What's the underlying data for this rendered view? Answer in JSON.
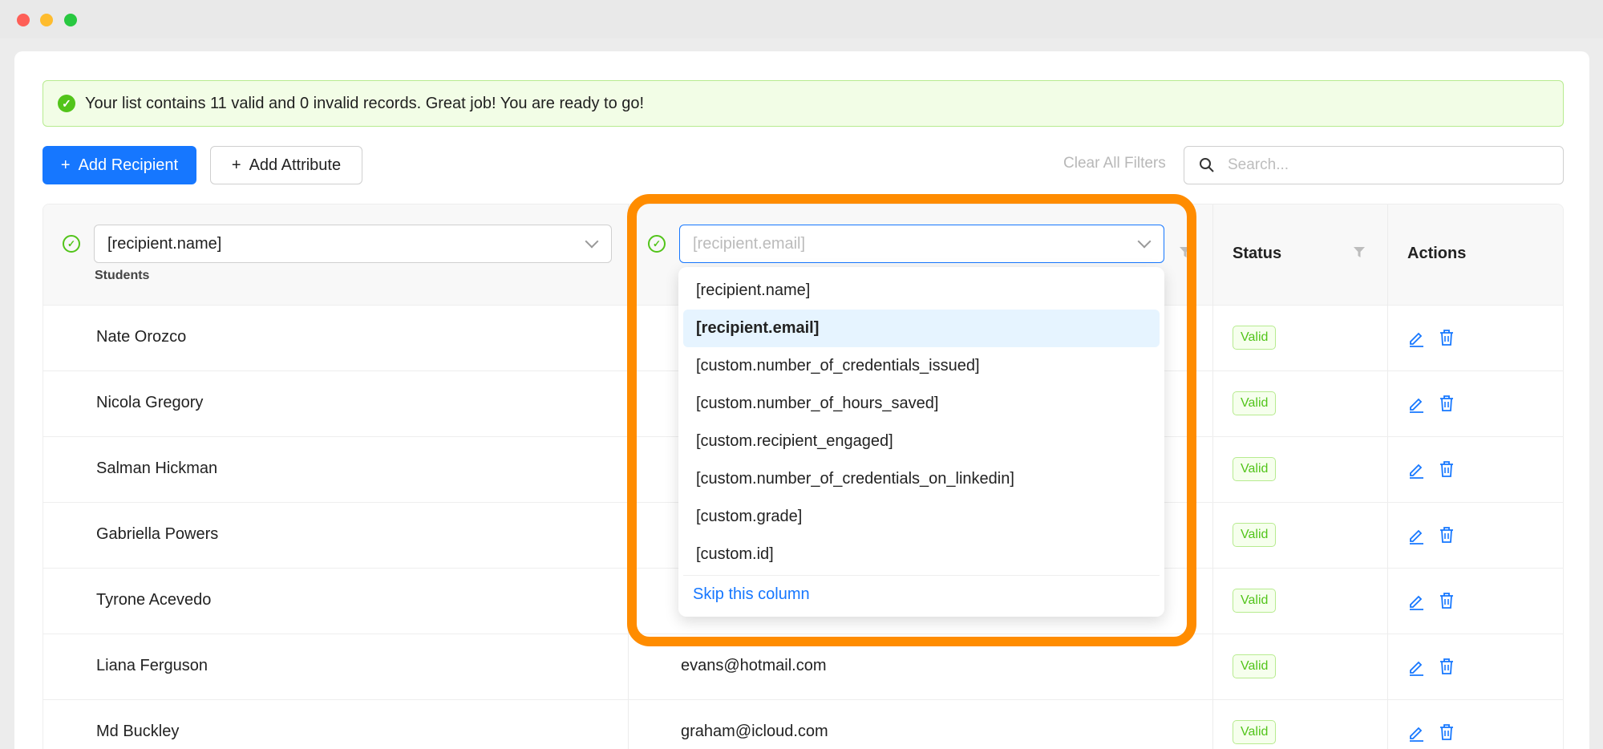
{
  "banner": {
    "message": "Your list contains 11 valid and 0 invalid records. Great job! You are ready to go!"
  },
  "toolbar": {
    "add_recipient": "Add Recipient",
    "add_attribute": "Add Attribute",
    "clear_filters": "Clear All Filters",
    "search_placeholder": "Search..."
  },
  "table": {
    "name_column": {
      "selected": "[recipient.name]",
      "sublabel": "Students"
    },
    "email_column": {
      "placeholder": "[recipient.email]"
    },
    "status_header": "Status",
    "actions_header": "Actions",
    "rows": [
      {
        "name": "Nate Orozco",
        "email": "",
        "status": "Valid"
      },
      {
        "name": "Nicola Gregory",
        "email": "",
        "status": "Valid"
      },
      {
        "name": "Salman Hickman",
        "email": "",
        "status": "Valid"
      },
      {
        "name": "Gabriella Powers",
        "email": "",
        "status": "Valid"
      },
      {
        "name": "Tyrone Acevedo",
        "email": "",
        "status": "Valid"
      },
      {
        "name": "Liana Ferguson",
        "email": "evans@hotmail.com",
        "status": "Valid"
      },
      {
        "name": "Md Buckley",
        "email": "graham@icloud.com",
        "status": "Valid"
      }
    ]
  },
  "dropdown": {
    "options": [
      "[recipient.name]",
      "[recipient.email]",
      "[custom.number_of_credentials_issued]",
      "[custom.number_of_hours_saved]",
      "[custom.recipient_engaged]",
      "[custom.number_of_credentials_on_linkedin]",
      "[custom.grade]",
      "[custom.id]"
    ],
    "selected_index": 1,
    "skip_label": "Skip this column"
  },
  "colors": {
    "primary": "#1677ff",
    "success": "#52c41a",
    "highlight": "#ff8c00"
  }
}
